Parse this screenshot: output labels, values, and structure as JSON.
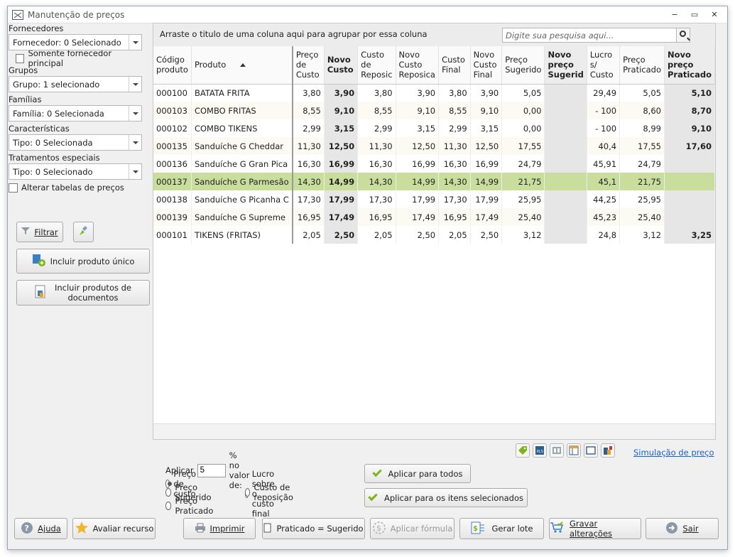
{
  "window": {
    "title": "Manutenção de preços",
    "controls": [
      "−",
      "▭",
      "✕"
    ]
  },
  "filters": {
    "fornecedores_label": "Fornecedores",
    "fornecedor_value": "Fornecedor: 0 Selecionado",
    "somente_principal": "Somente fornecedor principal",
    "grupos_label": "Grupos",
    "grupo_value": "Grupo: 1 selecionado",
    "familias_label": "Famílias",
    "familia_value": "Família: 0 Selecionada",
    "caracteristicas_label": "Características",
    "caracteristica_value": "Tipo: 0 Selecionada",
    "tratamentos_label": "Tratamentos especiais",
    "tratamento_value": "Tipo: 0 Selecionado",
    "alterar_tabelas": "Alterar tabelas de preços",
    "filtrar": "Filtrar",
    "incluir_unico": "Incluir produto único",
    "incluir_docs_line1": "Incluir produtos de",
    "incluir_docs_line2": "documentos"
  },
  "grid": {
    "group_hint": "Arraste o titulo de uma coluna aqui para agrupar por essa coluna",
    "search_placeholder": "Digite sua pesquisa aqui...",
    "columns": [
      "Código produto",
      "Produto",
      "Preço de Custo",
      "Novo Custo",
      "Custo de Reposic",
      "Novo Custo Reposica",
      "Custo Final",
      "Novo Custo Final",
      "Preço Sugerido",
      "Novo preço Sugerid",
      "Lucro s/ Custo",
      "Preço Praticado",
      "Novo preço Praticado"
    ],
    "rows": [
      [
        "000100",
        "BATATA FRITA",
        "3,80",
        "3,90",
        "3,80",
        "3,90",
        "3,80",
        "3,90",
        "5,05",
        "",
        "29,49",
        "5,05",
        "5,10"
      ],
      [
        "000103",
        "COMBO FRITAS",
        "8,55",
        "9,10",
        "8,55",
        "9,10",
        "8,55",
        "9,10",
        "0,00",
        "",
        "- 100",
        "8,60",
        "8,70"
      ],
      [
        "000102",
        "COMBO TIKENS",
        "2,99",
        "3,15",
        "2,99",
        "3,15",
        "2,99",
        "3,15",
        "0,00",
        "",
        "- 100",
        "8,99",
        "9,10"
      ],
      [
        "000135",
        "Sanduíche G Cheddar",
        "11,30",
        "12,50",
        "11,30",
        "12,50",
        "11,30",
        "12,50",
        "17,55",
        "",
        "40,4",
        "17,55",
        "17,60"
      ],
      [
        "000136",
        "Sanduíche G Gran Pica",
        "16,30",
        "16,99",
        "16,30",
        "16,99",
        "16,30",
        "16,99",
        "24,79",
        "",
        "45,91",
        "24,79",
        ""
      ],
      [
        "000137",
        "Sanduíche G Parmesão",
        "14,30",
        "14,99",
        "14,30",
        "14,99",
        "14,30",
        "14,99",
        "21,75",
        "",
        "45,1",
        "21,75",
        ""
      ],
      [
        "000138",
        "Sanduíche G Picanha C",
        "17,30",
        "17,99",
        "17,30",
        "17,99",
        "17,30",
        "17,99",
        "25,95",
        "",
        "44,25",
        "25,95",
        ""
      ],
      [
        "000139",
        "Sanduíche G Supreme",
        "16,95",
        "17,49",
        "16,95",
        "17,49",
        "16,95",
        "17,49",
        "25,40",
        "",
        "45,23",
        "25,40",
        ""
      ],
      [
        "000101",
        "TIKENS (FRITAS)",
        "2,05",
        "2,50",
        "2,05",
        "2,50",
        "2,05",
        "2,50",
        "3,12",
        "",
        "24,8",
        "3,12",
        "3,25"
      ]
    ],
    "selected_row_index": 5
  },
  "apply": {
    "aplicar_label": "Aplicar",
    "percent_value": "5",
    "suffix": "% no valor de:",
    "radio_preco_custo": "Preço de custo",
    "radio_preco_sugerido": "Preço Sugerido",
    "radio_preco_praticado": "Preço Praticado",
    "radio_lucro": "Lucro sobre o custo final",
    "radio_reposicao": "Custo de reposição",
    "btn_todos": "Aplicar para todos",
    "btn_selecionados": "Aplicar para os itens selecionados",
    "simulacao": "Simulação de preço"
  },
  "footer": {
    "ajuda": "Ajuda",
    "avaliar": "Avaliar recurso",
    "imprimir": "Imprimir",
    "praticado_sugerido": "Praticado = Sugerido",
    "aplicar_formula": "Aplicar fórmula",
    "gerar_lote": "Gerar lote",
    "gravar": "Gravar alterações",
    "sair": "Sair"
  },
  "colors": {
    "accent_green": "#7cb518",
    "selected_row": "#c9dd9d",
    "link": "#1a5fc9"
  }
}
